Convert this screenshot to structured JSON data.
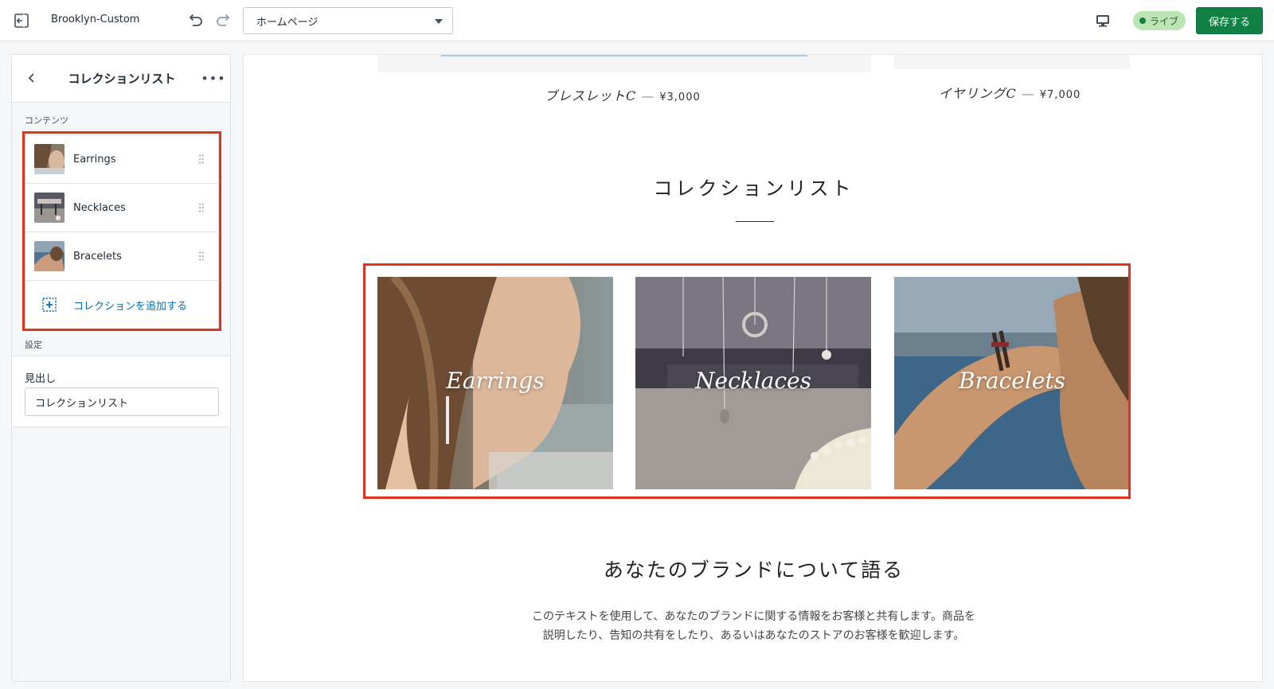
{
  "topbar": {
    "theme_name": "Brooklyn-Custom",
    "page_select": "ホームページ",
    "live_label": "ライブ",
    "save_label": "保存する"
  },
  "sidebar": {
    "title": "コレクションリスト",
    "more_label": "•••",
    "content_label": "コンテンツ",
    "items": [
      {
        "label": "Earrings"
      },
      {
        "label": "Necklaces"
      },
      {
        "label": "Bracelets"
      }
    ],
    "add_label": "コレクションを追加する",
    "settings_label": "設定",
    "heading_field_label": "見出し",
    "heading_field_value": "コレクションリスト"
  },
  "preview": {
    "products": [
      {
        "name": "ブレスレットC",
        "sep": "—",
        "price": "¥3,000"
      },
      {
        "name": "イヤリングC",
        "sep": "—",
        "price": "¥7,000"
      }
    ],
    "collection_title": "コレクションリスト",
    "collections": [
      {
        "name": "Earrings"
      },
      {
        "name": "Necklaces"
      },
      {
        "name": "Bracelets"
      }
    ],
    "brand_title": "あなたのブランドについて語る",
    "brand_text_1": "このテキストを使用して、あなたのブランドに関する情報をお客様と共有します。商品を",
    "brand_text_2": "説明したり、告知の共有をしたり、あるいはあなたのストアのお客様を歓迎します。"
  },
  "colors": {
    "accent_green": "#108043",
    "link_blue": "#006fbb",
    "highlight_red": "#e0341e"
  },
  "icons": [
    "exit-icon",
    "undo-icon",
    "redo-icon",
    "chevron-down-icon",
    "desktop-icon",
    "back-chevron-icon",
    "more-icon",
    "drag-handle-icon",
    "add-icon"
  ]
}
